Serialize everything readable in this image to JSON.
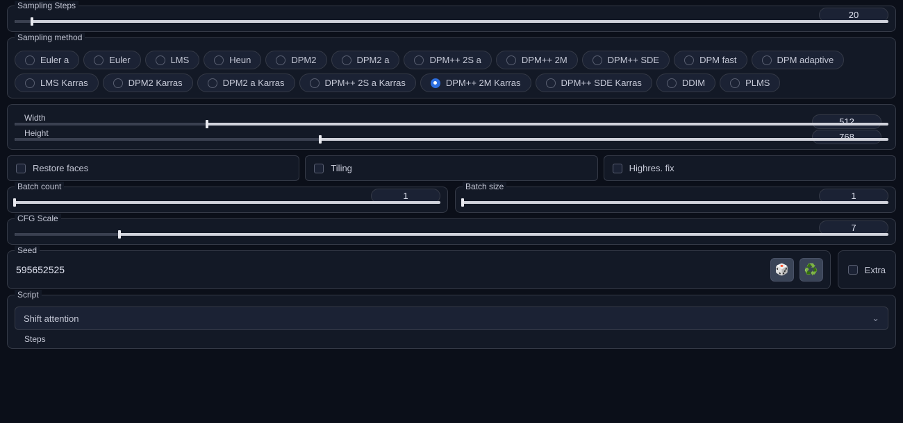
{
  "sampling_steps": {
    "label": "Sampling Steps",
    "value": 20,
    "fill_pct": 2
  },
  "sampling_method": {
    "label": "Sampling method",
    "options": [
      "Euler a",
      "Euler",
      "LMS",
      "Heun",
      "DPM2",
      "DPM2 a",
      "DPM++ 2S a",
      "DPM++ 2M",
      "DPM++ SDE",
      "DPM fast",
      "DPM adaptive",
      "LMS Karras",
      "DPM2 Karras",
      "DPM2 a Karras",
      "DPM++ 2S a Karras",
      "DPM++ 2M Karras",
      "DPM++ SDE Karras",
      "DDIM",
      "PLMS"
    ],
    "selected": "DPM++ 2M Karras"
  },
  "width": {
    "label": "Width",
    "value": 512,
    "fill_pct": 22
  },
  "height": {
    "label": "Height",
    "value": 768,
    "fill_pct": 35
  },
  "checks": {
    "restore_faces": {
      "label": "Restore faces",
      "checked": false
    },
    "tiling": {
      "label": "Tiling",
      "checked": false
    },
    "highres_fix": {
      "label": "Highres. fix",
      "checked": false
    }
  },
  "batch_count": {
    "label": "Batch count",
    "value": 1,
    "fill_pct": 0
  },
  "batch_size": {
    "label": "Batch size",
    "value": 1,
    "fill_pct": 0
  },
  "cfg_scale": {
    "label": "CFG Scale",
    "value": 7,
    "fill_pct": 12
  },
  "seed": {
    "label": "Seed",
    "value": "595652525",
    "dice_icon": "🎲",
    "recycle_icon": "♻️"
  },
  "extra": {
    "label": "Extra",
    "checked": false
  },
  "script": {
    "label": "Script",
    "selected": "Shift attention"
  },
  "steps": {
    "label": "Steps"
  }
}
